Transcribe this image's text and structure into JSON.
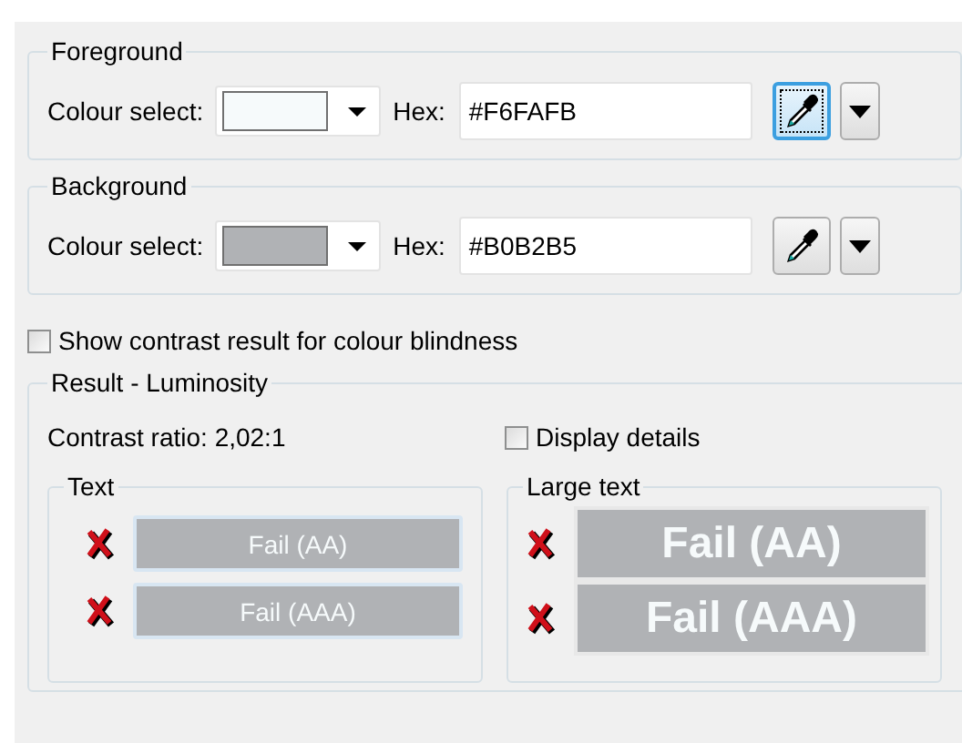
{
  "colour_groups": [
    {
      "title": "Foreground",
      "select_label": "Colour select:",
      "color": "#f6fafb",
      "hex_label": "Hex:",
      "hex": "#F6FAFB",
      "picker_focused": true
    },
    {
      "title": "Background",
      "select_label": "Colour select:",
      "color": "#b0b2b5",
      "hex_label": "Hex:",
      "hex": "#B0B2B5",
      "picker_focused": false
    }
  ],
  "colour_blindness": {
    "label": "Show contrast result for colour blindness",
    "checked": false
  },
  "result": {
    "title": "Result - Luminosity",
    "contrast_ratio": "Contrast ratio: 2,02:1",
    "details": {
      "label": "Display details",
      "checked": false
    },
    "groups": [
      {
        "title": "Text",
        "kind": "normal",
        "rows": [
          {
            "label": "Fail (AA)",
            "passed": false
          },
          {
            "label": "Fail (AAA)",
            "passed": false
          }
        ]
      },
      {
        "title": "Large text",
        "kind": "large",
        "rows": [
          {
            "label": "Fail (AA)",
            "passed": false
          },
          {
            "label": "Fail (AAA)",
            "passed": false
          }
        ]
      }
    ]
  }
}
